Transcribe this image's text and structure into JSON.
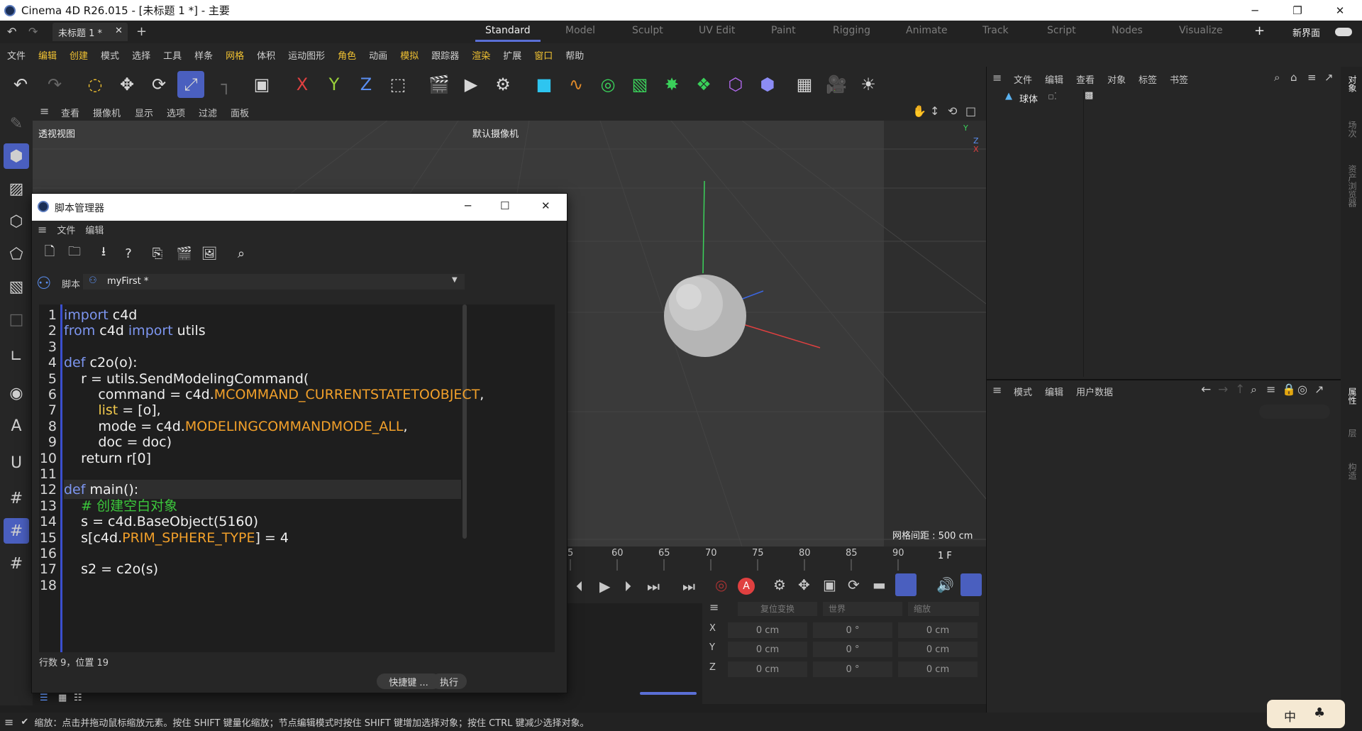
{
  "window": {
    "title": "Cinema 4D R26.015 - [未标题 1 *] - 主要"
  },
  "doc_tab": {
    "label": "未标题 1 *"
  },
  "layout_tabs": [
    "Standard",
    "Model",
    "Sculpt",
    "UV Edit",
    "Paint",
    "Rigging",
    "Animate",
    "Track",
    "Script",
    "Nodes",
    "Visualize"
  ],
  "new_layout": "新界面",
  "menu": [
    "文件",
    "编辑",
    "创建",
    "模式",
    "选择",
    "工具",
    "样条",
    "网格",
    "体积",
    "运动图形",
    "角色",
    "动画",
    "模拟",
    "跟踪器",
    "渲染",
    "扩展",
    "窗口",
    "帮助"
  ],
  "axis_buttons": [
    "X",
    "Y",
    "Z"
  ],
  "viewport": {
    "menu": [
      "查看",
      "摄像机",
      "显示",
      "选项",
      "过滤",
      "面板"
    ],
    "label": "透视视图",
    "camera": "默认摄像机",
    "grid_spacing": "网格间距 : 500 cm",
    "axis_labels": [
      "Y",
      "Z",
      "X"
    ]
  },
  "timeline": {
    "ticks": [
      "5",
      "60",
      "65",
      "70",
      "75",
      "80",
      "85",
      "90"
    ],
    "frame": "1 F"
  },
  "coords": {
    "headers": [
      "复位变换",
      "世界",
      "缩放"
    ],
    "rows": [
      {
        "axis": "X",
        "pos": "0 cm",
        "rot": "0 °",
        "scale": "0 cm"
      },
      {
        "axis": "Y",
        "pos": "0 cm",
        "rot": "0 °",
        "scale": "0 cm"
      },
      {
        "axis": "Z",
        "pos": "0 cm",
        "rot": "0 °",
        "scale": "0 cm"
      }
    ]
  },
  "object_manager": {
    "menu": [
      "文件",
      "编辑",
      "查看",
      "对象",
      "标签",
      "书签"
    ],
    "object": "球体"
  },
  "attribute_manager": {
    "menu": [
      "模式",
      "编辑",
      "用户数据"
    ]
  },
  "side_tabs": [
    "对象",
    "场次",
    "资产浏览器",
    "属性",
    "层",
    "构造"
  ],
  "script_manager": {
    "title": "脚本管理器",
    "menu": [
      "文件",
      "编辑"
    ],
    "script_label": "脚本",
    "script_name": "myFirst *",
    "status": "行数 9，位置 19",
    "shortcut_button": "快捷键 ...",
    "execute_button": "执行",
    "code": [
      {
        "n": "1",
        "t": "import c4d"
      },
      {
        "n": "2",
        "t": "from c4d import utils"
      },
      {
        "n": "3",
        "t": ""
      },
      {
        "n": "4",
        "t": "def c2o(o):"
      },
      {
        "n": "5",
        "t": "    r = utils.SendModelingCommand("
      },
      {
        "n": "6",
        "t": "        command = c4d.MCOMMAND_CURRENTSTATETOOBJECT,"
      },
      {
        "n": "7",
        "t": "        list = [o],"
      },
      {
        "n": "8",
        "t": "        mode = c4d.MODELINGCOMMANDMODE_ALL,"
      },
      {
        "n": "9",
        "t": "        doc = doc)"
      },
      {
        "n": "10",
        "t": "    return r[0]"
      },
      {
        "n": "11",
        "t": ""
      },
      {
        "n": "12",
        "t": "def main():"
      },
      {
        "n": "13",
        "t": "    # 创建空白对象"
      },
      {
        "n": "14",
        "t": "    s = c4d.BaseObject(5160)"
      },
      {
        "n": "15",
        "t": "    s[c4d.PRIM_SPHERE_TYPE] = 4"
      },
      {
        "n": "16",
        "t": ""
      },
      {
        "n": "17",
        "t": "    s2 = c2o(s)"
      },
      {
        "n": "18",
        "t": ""
      }
    ]
  },
  "status_bar": "缩放：点击并拖动鼠标缩放元素。按住 SHIFT 键量化缩放；节点编辑模式时按住 SHIFT 键增加选择对象；按住 CTRL 键减少选择对象。",
  "ime": {
    "label": "中"
  }
}
